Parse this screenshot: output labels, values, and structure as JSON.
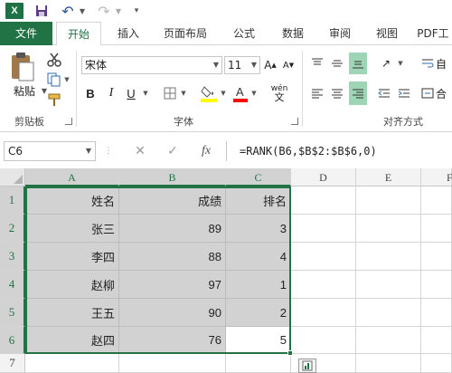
{
  "quick_access": {
    "app_logo": "X",
    "icons": [
      "excel-logo-icon",
      "save-icon",
      "undo-icon",
      "redo-icon",
      "customize-qat-icon"
    ]
  },
  "tabs": [
    "文件",
    "开始",
    "插入",
    "页面布局",
    "公式",
    "数据",
    "审阅",
    "视图",
    "PDF工"
  ],
  "active_tab": "开始",
  "ribbon": {
    "clipboard": {
      "paste_label": "粘贴",
      "group_label": "剪贴板"
    },
    "font": {
      "font_name": "宋体",
      "font_size": "11",
      "group_label": "字体",
      "bold": "B",
      "italic": "I",
      "underline": "U",
      "phonetic": "wén"
    },
    "alignment": {
      "group_label": "对齐方式",
      "wrap": "自",
      "merge": "合"
    },
    "colors": {
      "accent": "#217346",
      "fill_yellow": "#ffff00",
      "font_red": "#ff0000"
    }
  },
  "formula_bar": {
    "name_box": "C6",
    "cancel_icon": "✕",
    "enter_icon": "✓",
    "function_icon": "fx",
    "formula": "=RANK(B6,$B$2:$B$6,0)"
  },
  "sheet": {
    "columns": [
      "A",
      "B",
      "C",
      "D",
      "E",
      "F"
    ],
    "rows": [
      "1",
      "2",
      "3",
      "4",
      "5",
      "6",
      "7"
    ],
    "headers": [
      "姓名",
      "成绩",
      "排名"
    ],
    "data": [
      [
        "张三",
        "89",
        "3"
      ],
      [
        "李四",
        "88",
        "4"
      ],
      [
        "赵柳",
        "97",
        "1"
      ],
      [
        "王五",
        "90",
        "2"
      ],
      [
        "赵四",
        "76",
        "5"
      ]
    ],
    "active_cell": "C6"
  }
}
